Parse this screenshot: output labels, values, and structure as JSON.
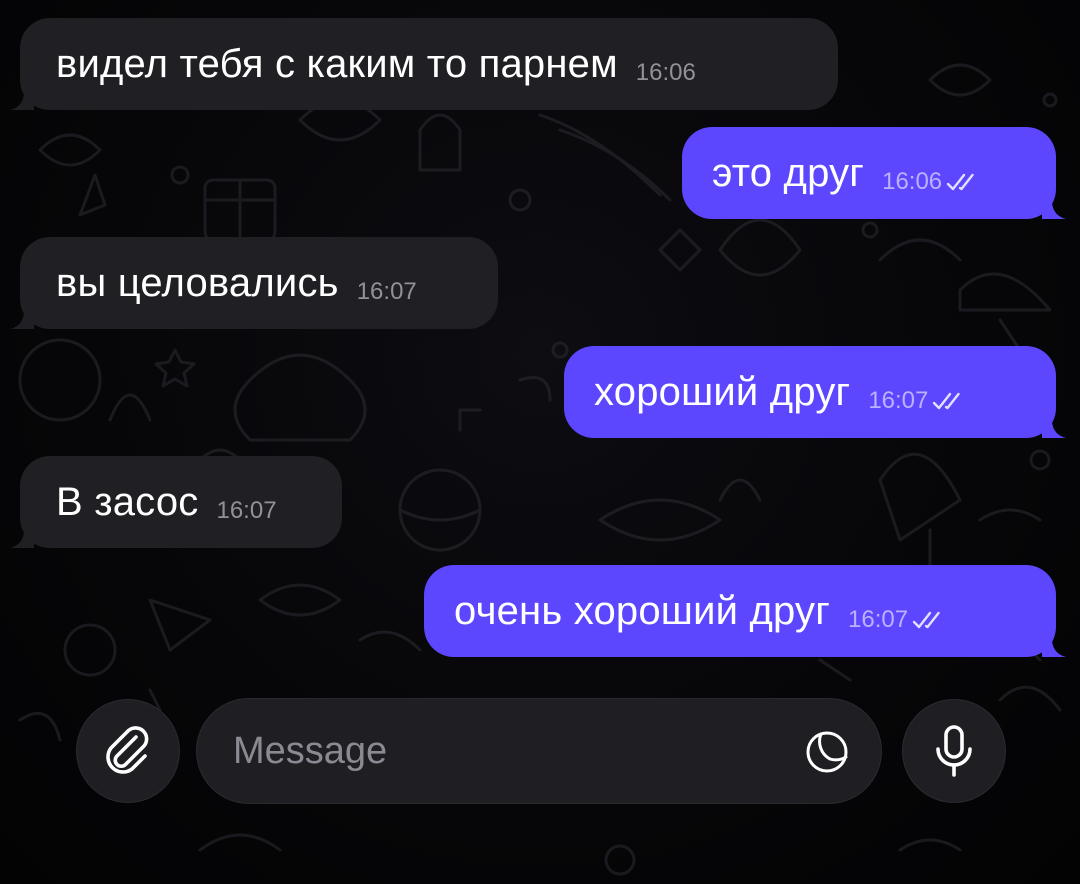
{
  "chat": {
    "messages": [
      {
        "direction": "incoming",
        "text": "видел тебя с каким то парнем",
        "time": "16:06"
      },
      {
        "direction": "outgoing",
        "text": "это друг",
        "time": "16:06",
        "status": "read"
      },
      {
        "direction": "incoming",
        "text": "вы целовались",
        "time": "16:07"
      },
      {
        "direction": "outgoing",
        "text": "хороший друг",
        "time": "16:07",
        "status": "read"
      },
      {
        "direction": "incoming",
        "text": "В засос",
        "time": "16:07"
      },
      {
        "direction": "outgoing",
        "text": "очень хороший друг",
        "time": "16:07",
        "status": "read"
      }
    ]
  },
  "composer": {
    "placeholder": "Message",
    "value": "",
    "attach_icon": "paperclip-icon",
    "sticker_icon": "sticker-icon",
    "mic_icon": "microphone-icon"
  },
  "colors": {
    "background": "#050507",
    "incoming_bubble": "#1f1f24",
    "outgoing_bubble": "#5c47ff",
    "text": "#ffffff",
    "placeholder": "#8a8a92"
  }
}
